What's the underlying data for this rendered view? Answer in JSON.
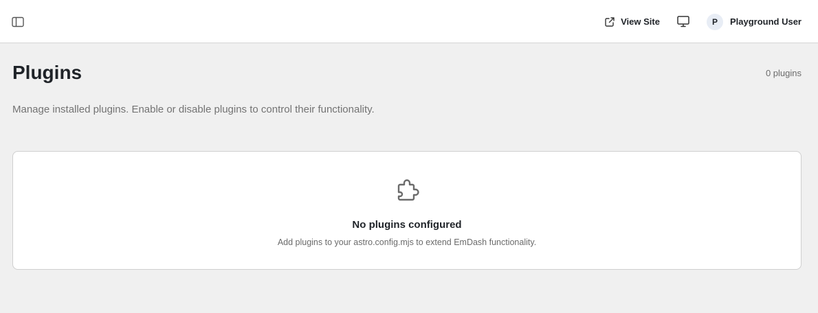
{
  "topbar": {
    "view_site_label": "View Site",
    "user": {
      "avatar_initial": "P",
      "name": "Playground User"
    },
    "icons": {
      "sidebar_toggle": "sidebar-toggle-icon",
      "external_link": "external-link-icon",
      "screen": "monitor-icon"
    }
  },
  "page": {
    "title": "Plugins",
    "count": "0 plugins",
    "description": "Manage installed plugins. Enable or disable plugins to control their functionality."
  },
  "empty_state": {
    "icon": "puzzle-icon",
    "title": "No plugins configured",
    "subtitle": "Add plugins to your astro.config.mjs to extend EmDash functionality."
  },
  "colors": {
    "background": "#f0f0f0",
    "card": "#ffffff",
    "text": "#1f2328",
    "muted": "#737373"
  }
}
